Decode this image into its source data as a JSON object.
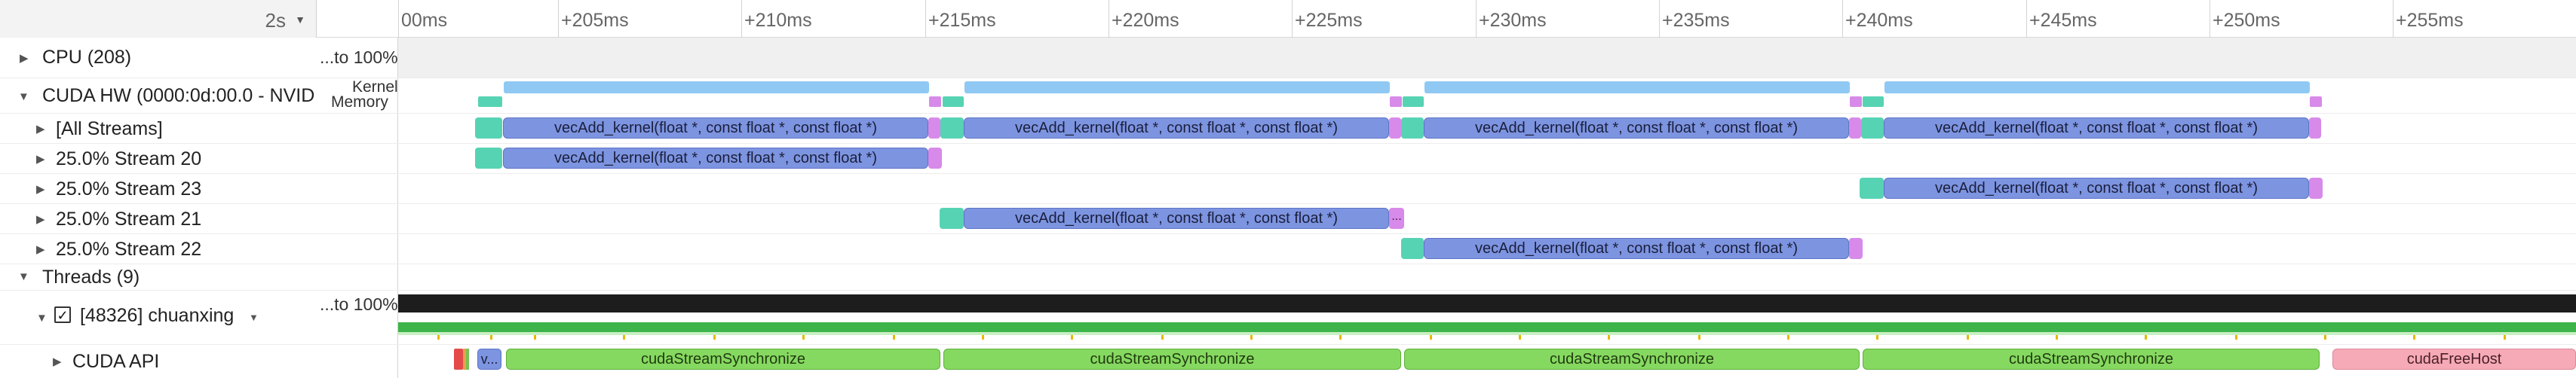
{
  "ruler": {
    "zoom": "2s",
    "ticks": [
      "00ms",
      "+205ms",
      "+210ms",
      "+215ms",
      "+220ms",
      "+225ms",
      "+230ms",
      "+235ms",
      "+240ms",
      "+245ms",
      "+250ms",
      "+255ms"
    ]
  },
  "rows": {
    "cpu": {
      "label": "CPU (208)",
      "value": "...to 100%"
    },
    "cuda_hw": {
      "label": "CUDA HW (0000:0d:00.0 - NVIDI",
      "value_line1": "Kernel",
      "value_line2": "Memory"
    },
    "all_streams": {
      "label": "[All Streams]"
    },
    "stream20": {
      "label": "25.0% Stream 20"
    },
    "stream23": {
      "label": "25.0% Stream 23"
    },
    "stream21": {
      "label": "25.0% Stream 21"
    },
    "stream22": {
      "label": "25.0% Stream 22"
    },
    "threads": {
      "label": "Threads (9)"
    },
    "process": {
      "label": "[48326] chuanxing",
      "value": "...to 100%"
    },
    "cuda_api": {
      "label": "CUDA API"
    }
  },
  "kernels": {
    "name": "vecAdd_kernel(float *, const float *, const float *)"
  },
  "api": {
    "short": "v...",
    "sync": "cudaStreamSynchronize",
    "free": "cudaFreeHost",
    "dots": "..."
  },
  "colors": {
    "kernel": "#7d94e0",
    "memcpy_htod": "#56d3b3",
    "memcpy_dtoh": "#d78ae9",
    "api_sync": "#86d960",
    "api_free": "#f6aab7",
    "thread_usage": "#1d1d1d"
  },
  "icons": {
    "expand": "triangle-right",
    "collapse": "triangle-down",
    "checkbox": "check"
  }
}
